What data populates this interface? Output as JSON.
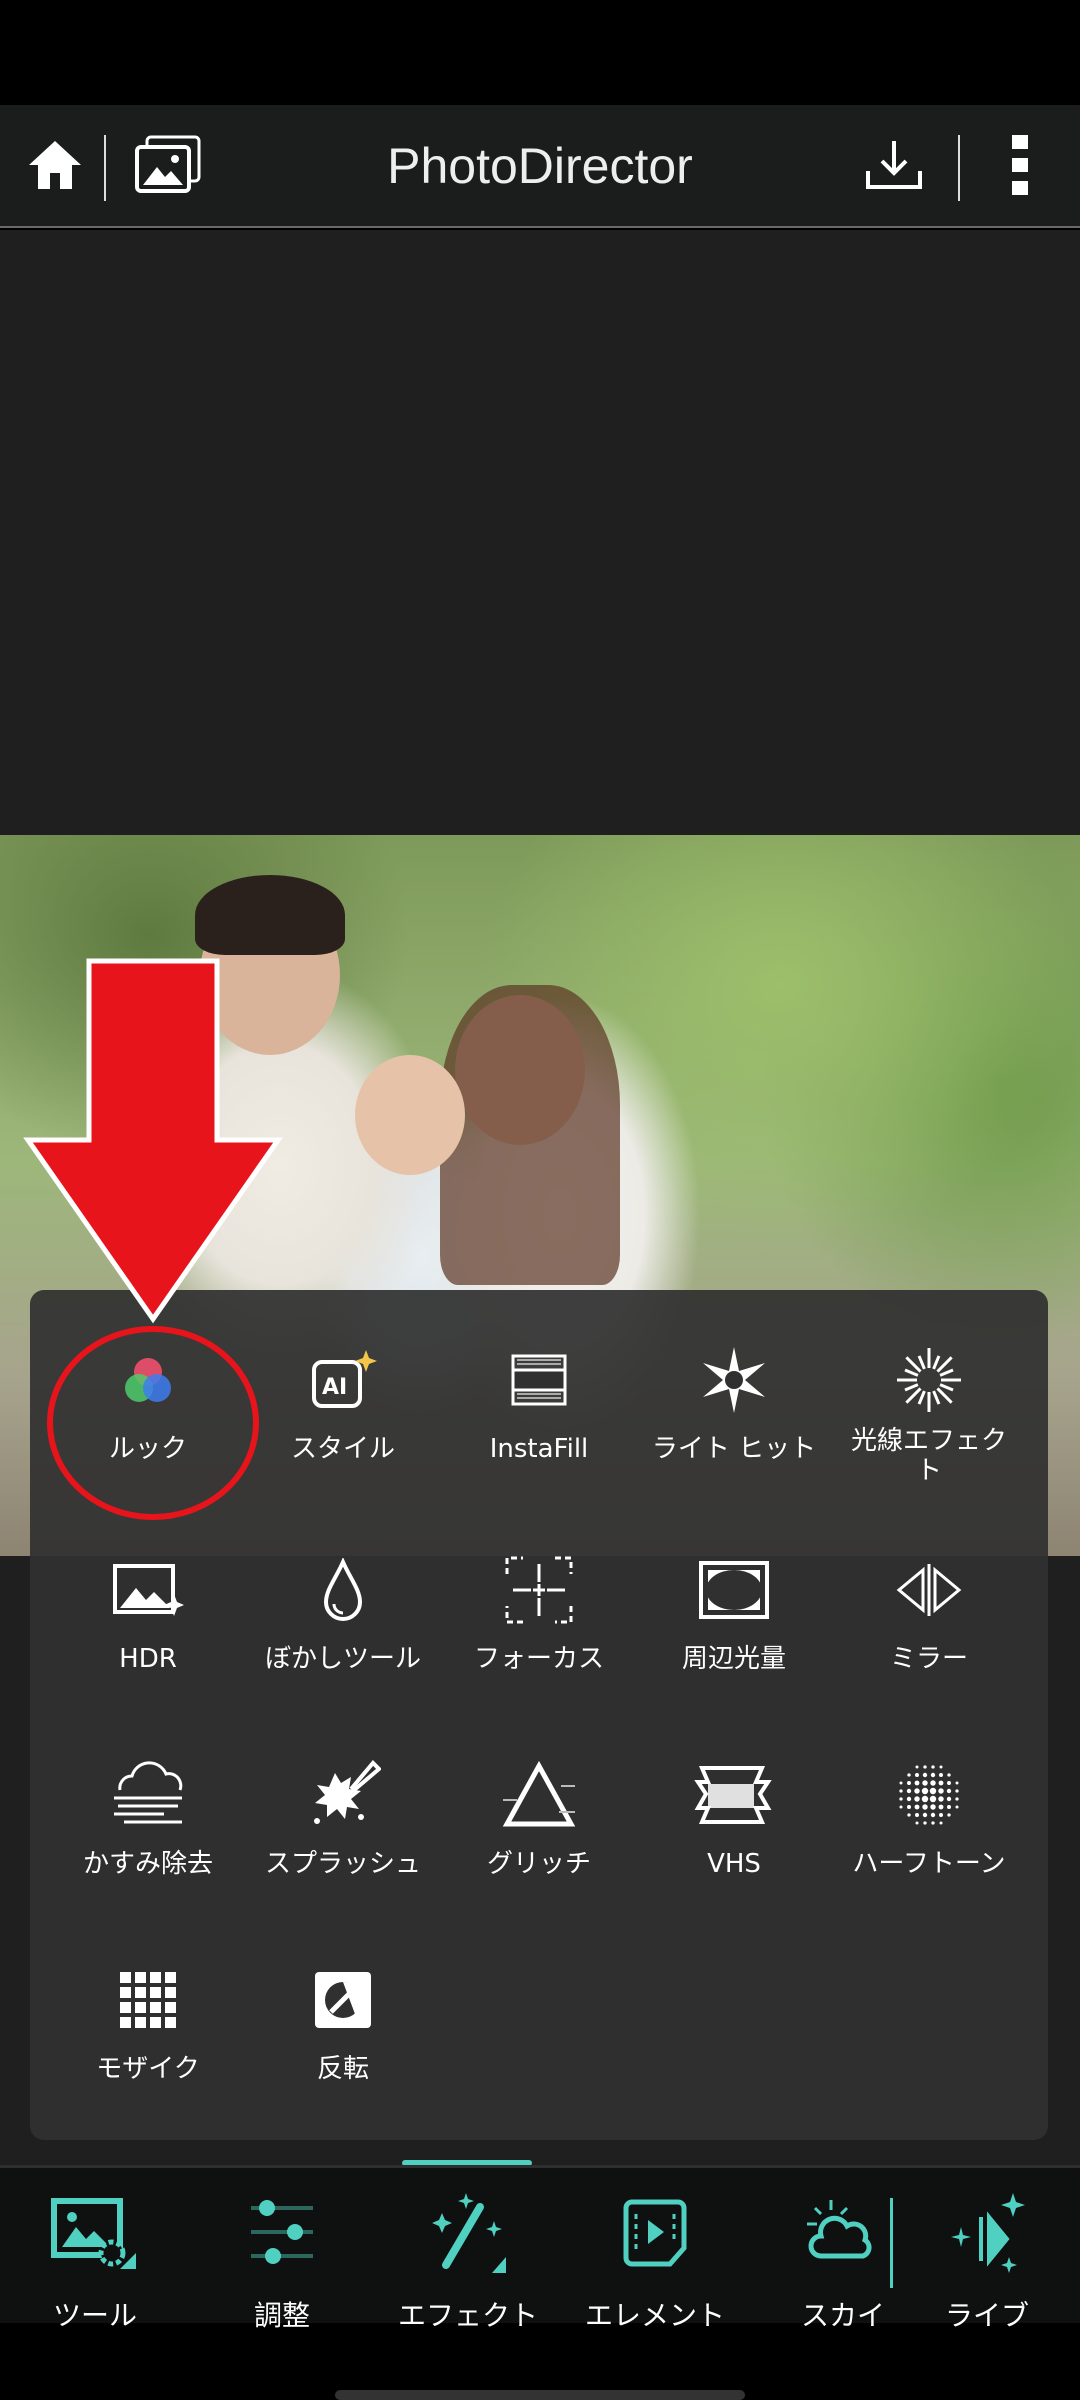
{
  "header": {
    "title": "PhotoDirector",
    "icons": [
      "home-icon",
      "gallery-icon",
      "download-icon",
      "more-vertical-icon"
    ]
  },
  "effects": [
    {
      "label": "ルック",
      "icon": "look-rgb-circles-icon"
    },
    {
      "label": "スタイル",
      "icon": "ai-style-icon",
      "icon_text": "AI"
    },
    {
      "label": "InstaFill",
      "icon": "instafill-icon"
    },
    {
      "label": "ライト ヒット",
      "icon": "light-hit-icon"
    },
    {
      "label": "光線エフェクト",
      "icon": "light-rays-icon"
    },
    {
      "label": "HDR",
      "icon": "hdr-icon"
    },
    {
      "label": "ぼかしツール",
      "icon": "blur-drop-icon"
    },
    {
      "label": "フォーカス",
      "icon": "focus-icon"
    },
    {
      "label": "周辺光量",
      "icon": "vignette-icon"
    },
    {
      "label": "ミラー",
      "icon": "mirror-icon"
    },
    {
      "label": "かすみ除去",
      "icon": "dehaze-icon"
    },
    {
      "label": "スプラッシュ",
      "icon": "splash-icon"
    },
    {
      "label": "グリッチ",
      "icon": "glitch-icon"
    },
    {
      "label": "VHS",
      "icon": "vhs-icon"
    },
    {
      "label": "ハーフトーン",
      "icon": "halftone-icon"
    },
    {
      "label": "モザイク",
      "icon": "mosaic-icon"
    },
    {
      "label": "反転",
      "icon": "invert-icon"
    }
  ],
  "nav": {
    "active": "エフェクト",
    "tabs": [
      {
        "label": "ツール",
        "icon": "tools-icon"
      },
      {
        "label": "調整",
        "icon": "adjust-sliders-icon"
      },
      {
        "label": "エフェクト",
        "icon": "magic-wand-icon"
      },
      {
        "label": "エレメント",
        "icon": "element-icon"
      },
      {
        "label": "スカイ",
        "icon": "sky-icon"
      },
      {
        "label": "ライブ",
        "icon": "live-icon"
      }
    ]
  },
  "colors": {
    "accent": "#4fd0c0",
    "annotation": "#e8141c",
    "panel": "#303030"
  }
}
